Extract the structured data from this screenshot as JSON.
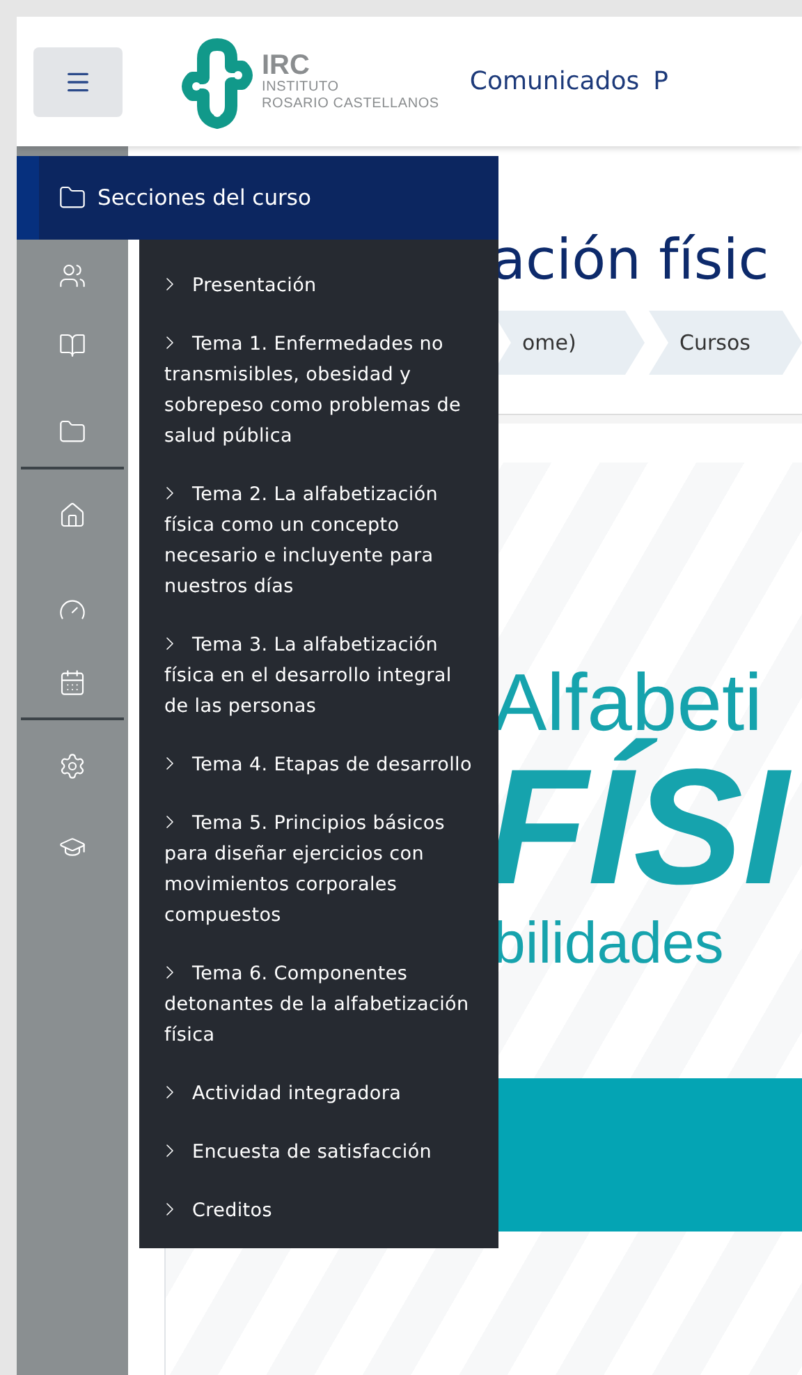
{
  "header": {
    "logo": {
      "title": "IRC",
      "subtitle_1": "INSTITUTO",
      "subtitle_2": "ROSARIO CASTELLANOS"
    },
    "nav_links": [
      "Comunicados",
      "P"
    ]
  },
  "sections_menu": {
    "title": "Secciones del curso",
    "items": [
      "Presentación",
      "Tema 1. Enfermedades no transmisibles, obesidad y sobrepeso como problemas de salud pública",
      "Tema 2. La alfabetización física como un concepto necesario e incluyente para nuestros días",
      "Tema 3. La alfabetización física en el desarrollo integral de las personas",
      "Tema 4. Etapas de desarrollo",
      "Tema 5. Principios básicos para diseñar ejercicios con movimientos corporales compuestos",
      "Tema 6. Componentes detonantes de la alfabetización física",
      "Actividad integradora",
      "Encuesta de satisfacción",
      "Creditos"
    ]
  },
  "page_title": "ación físic",
  "breadcrumb": [
    "ome)",
    "Cursos"
  ],
  "banner": {
    "line_1": "Alfabeti",
    "line_2": "FÍSI",
    "line_3": "bilidades"
  }
}
